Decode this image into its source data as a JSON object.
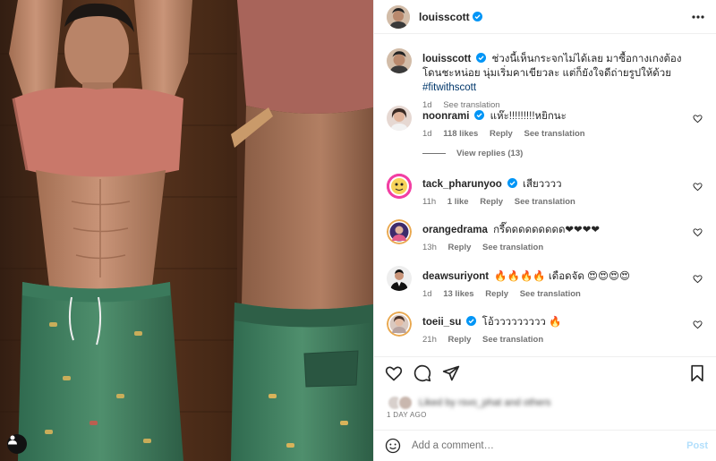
{
  "media": {
    "description_icon": "person-tag-icon"
  },
  "header": {
    "username": "louisscott",
    "verified": true,
    "more_icon": "more-dots-icon"
  },
  "caption": {
    "username": "louisscott",
    "text": "ช่วงนี้เห็นกระจกไม่ได้เลย มาซื้อกางเกงต้องโดนชะหน่อย นุ่มเริ่มคาเขียวละ แต่ก็ยังใจดีถ่ายรูปให้ด้วย",
    "hashtag": "#fitwithscott",
    "time": "1d",
    "see_translation": "See translation"
  },
  "comments": [
    {
      "username": "noonrami",
      "verified": true,
      "text": "แห๊ะ!!!!!!!!!หยิกนะ",
      "time": "1d",
      "likes": "118 likes",
      "reply": "Reply",
      "see_translation": "See translation"
    },
    {
      "username": "tack_pharunyoo",
      "verified": true,
      "text": "เสียวววว",
      "time": "11h",
      "likes": "1 like",
      "reply": "Reply",
      "see_translation": "See translation"
    },
    {
      "username": "orangedrama",
      "verified": false,
      "text": "กรี๊ดดดดดดดดด❤❤❤❤",
      "time": "13h",
      "likes": "",
      "reply": "Reply",
      "see_translation": "See translation"
    },
    {
      "username": "deawsuriyont",
      "verified": false,
      "text": "🔥🔥🔥🔥 เดือดจัด 😍😍😍😍",
      "time": "1d",
      "likes": "13 likes",
      "reply": "Reply",
      "see_translation": "See translation"
    },
    {
      "username": "toeii_su",
      "verified": true,
      "text": "โอ้ววววววววว 🔥",
      "time": "21h",
      "likes": "",
      "reply": "Reply",
      "see_translation": "See translation"
    }
  ],
  "view_replies": "View replies (13)",
  "actions": {
    "like_icon": "heart-icon",
    "comment_icon": "comment-bubble-icon",
    "share_icon": "paper-plane-icon",
    "save_icon": "bookmark-icon"
  },
  "likes": {
    "text": "Liked by rsvo_phat and others"
  },
  "date": "1 DAY AGO",
  "add_comment": {
    "placeholder": "Add a comment…",
    "post_label": "Post",
    "emoji_icon": "emoji-smile-icon"
  },
  "colors": {
    "verified": "#0095f6",
    "link": "#00376b",
    "secondary_text": "#737373",
    "post_disabled": "#b2dffc"
  }
}
